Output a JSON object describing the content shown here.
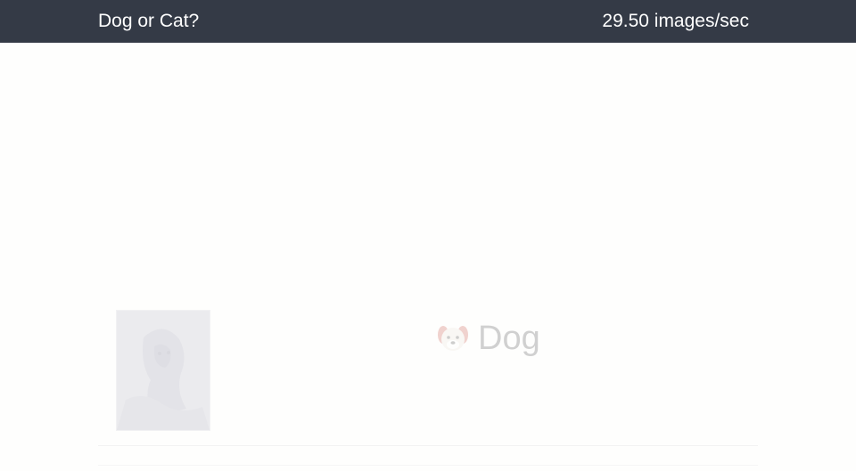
{
  "header": {
    "title": "Dog or Cat?",
    "rate_text": "29.50 images/sec"
  },
  "result": {
    "image_icon": "pet-photo-thumbnail",
    "prediction_icon": "dog-face-icon",
    "prediction_label": "Dog"
  },
  "colors": {
    "header_bg": "#343a46",
    "header_text": "#ffffff",
    "page_bg": "#fefefd"
  }
}
